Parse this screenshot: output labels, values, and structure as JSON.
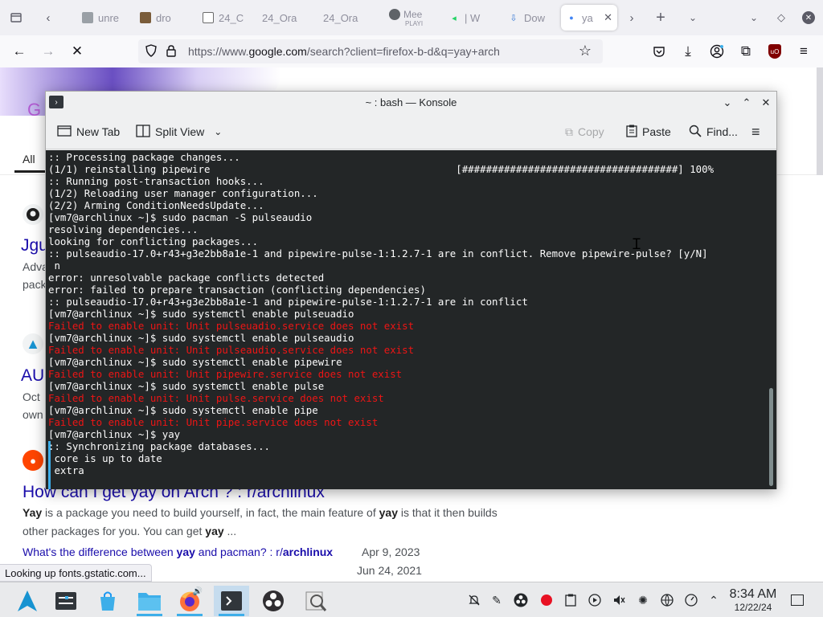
{
  "browser": {
    "tabs": [
      {
        "title": "unre",
        "icon": "github-icon",
        "color": "#9aa0a6"
      },
      {
        "title": "dro",
        "icon": "image-icon",
        "color": "#7a5c3a"
      },
      {
        "title": "24_C",
        "icon": "files-icon",
        "color": "#6b6b6b"
      },
      {
        "title": "24_Ora",
        "icon": "",
        "color": ""
      },
      {
        "title": "24_Ora",
        "icon": "",
        "color": ""
      },
      {
        "title": "Mee",
        "subtitle": "PLAYI",
        "icon": "meet-icon",
        "color": "#5f6368"
      },
      {
        "title": "| W",
        "icon": "whatsapp-icon",
        "color": "#25d366"
      },
      {
        "title": "Dow",
        "icon": "download-icon",
        "color": "#3a7bd5"
      },
      {
        "title": "ya",
        "icon": "loading-dot-icon",
        "color": "#4285f4"
      }
    ],
    "url_prefix": "https://www.",
    "url_domain": "google.com",
    "url_path": "/search?client=firefox-b-d&q=yay+arch",
    "status_text": "Looking up fonts.gstatic.com..."
  },
  "google": {
    "logo_letter": "G",
    "tab_all": "All",
    "results": [
      {
        "title": "Jgu",
        "snippet_1": "Adva",
        "snippet_2": "pack"
      },
      {
        "title": "AU",
        "snippet_1": "Oct",
        "snippet_2": "own"
      }
    ],
    "reddit_title": "How can I get yay on Arch ? : r/archlinux",
    "reddit_snippet_1": [
      {
        "t": "Yay",
        "b": true
      },
      {
        "t": " is a package you need to build yourself, in fact, the main feature of ",
        "b": false
      },
      {
        "t": "yay",
        "b": true
      },
      {
        "t": " is that it then builds",
        "b": false
      }
    ],
    "reddit_snippet_2": [
      {
        "t": "other packages for you. You can get ",
        "b": false
      },
      {
        "t": "yay",
        "b": true
      },
      {
        "t": " ...",
        "b": false
      }
    ],
    "related": [
      {
        "t": "What's the difference between ",
        "b": false
      },
      {
        "t": "yay",
        "b": true
      },
      {
        "t": " and pacman? : r/",
        "b": false
      },
      {
        "t": "archlinux",
        "b": true
      }
    ],
    "related_date": "Apr 9, 2023",
    "other_date": "Jun 24, 2021"
  },
  "konsole": {
    "title": "~ : bash — Konsole",
    "toolbar": {
      "new_tab": "New Tab",
      "split_view": "Split View",
      "copy": "Copy",
      "paste": "Paste",
      "find": "Find..."
    },
    "lines": [
      {
        "text": ":: Processing package changes...",
        "err": false
      },
      {
        "text": "(1/1) reinstalling pipewire                                         [####################################] 100%",
        "err": false
      },
      {
        "text": ":: Running post-transaction hooks...",
        "err": false
      },
      {
        "text": "(1/2) Reloading user manager configuration...",
        "err": false
      },
      {
        "text": "(2/2) Arming ConditionNeedsUpdate...",
        "err": false
      },
      {
        "text": "[vm7@archlinux ~]$ sudo pacman -S pulseaudio",
        "err": false
      },
      {
        "text": "resolving dependencies...",
        "err": false
      },
      {
        "text": "looking for conflicting packages...",
        "err": false
      },
      {
        "text": ":: pulseaudio-17.0+r43+g3e2bb8a1e-1 and pipewire-pulse-1:1.2.7-1 are in conflict. Remove pipewire-pulse? [y/N]",
        "err": false
      },
      {
        "text": " n",
        "err": false
      },
      {
        "text": "error: unresolvable package conflicts detected",
        "err": false
      },
      {
        "text": "error: failed to prepare transaction (conflicting dependencies)",
        "err": false
      },
      {
        "text": ":: pulseaudio-17.0+r43+g3e2bb8a1e-1 and pipewire-pulse-1:1.2.7-1 are in conflict",
        "err": false
      },
      {
        "text": "[vm7@archlinux ~]$ sudo systemctl enable pulseuadio",
        "err": false
      },
      {
        "text": "Failed to enable unit: Unit pulseuadio.service does not exist",
        "err": true
      },
      {
        "text": "[vm7@archlinux ~]$ sudo systemctl enable pulseaudio",
        "err": false
      },
      {
        "text": "Failed to enable unit: Unit pulseaudio.service does not exist",
        "err": true
      },
      {
        "text": "[vm7@archlinux ~]$ sudo systemctl enable pipewire",
        "err": false
      },
      {
        "text": "Failed to enable unit: Unit pipewire.service does not exist",
        "err": true
      },
      {
        "text": "[vm7@archlinux ~]$ sudo systemctl enable pulse",
        "err": false
      },
      {
        "text": "Failed to enable unit: Unit pulse.service does not exist",
        "err": true
      },
      {
        "text": "[vm7@archlinux ~]$ sudo systemctl enable pipe",
        "err": false
      },
      {
        "text": "Failed to enable unit: Unit pipe.service does not exist",
        "err": true
      },
      {
        "text": "[vm7@archlinux ~]$ yay",
        "err": false
      },
      {
        "text": ":: Synchronizing package databases...",
        "err": false
      },
      {
        "text": " core is up to date",
        "err": false
      },
      {
        "text": " extra",
        "err": false
      }
    ]
  },
  "taskbar": {
    "time": "8:34 AM",
    "date": "12/22/24"
  },
  "colors": {
    "terminal_bg": "#232627",
    "terminal_error": "#ed1515",
    "accent": "#3daee9",
    "google_link": "#1a0dab"
  }
}
